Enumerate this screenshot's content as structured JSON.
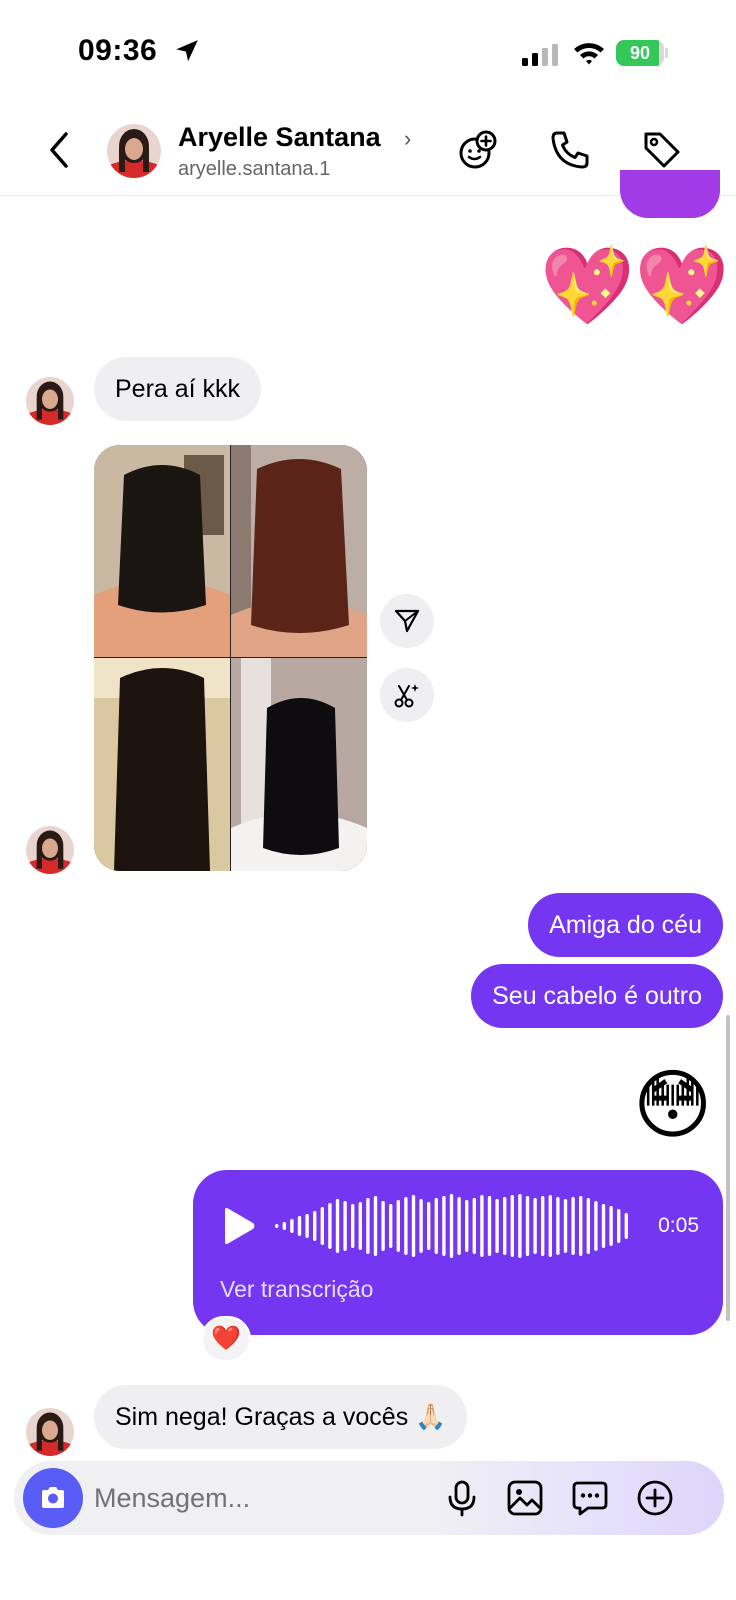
{
  "status_bar": {
    "time": "09:36",
    "battery_percent": "90",
    "battery_level": 0.9,
    "icons": [
      "location-arrow-icon",
      "cellular-signal-icon",
      "wifi-icon",
      "battery-icon"
    ]
  },
  "header": {
    "name": "Aryelle Santana",
    "chevron": "›",
    "handle": "aryelle.santana.1",
    "icons": [
      "back-icon",
      "add-sticker-icon",
      "phone-icon",
      "tag-icon"
    ]
  },
  "messages": {
    "m1_emoji": "💖💖",
    "m2_text": "Pera aí kkk",
    "m3_images": [
      "hair-photo-1",
      "hair-photo-2",
      "hair-photo-3",
      "hair-photo-4"
    ],
    "m4_text": "Amiga do céu",
    "m5_text": "Seu cabelo é outro",
    "m6_emoji": "😳",
    "m7_audio": {
      "duration": "0:05",
      "transcript_link": "Ver transcrição",
      "reaction": "❤️"
    },
    "m8_text": "Sim nega! Graças a vocês 🙏🏻"
  },
  "composer": {
    "placeholder": "Mensagem...",
    "icons": [
      "camera-icon",
      "microphone-icon",
      "gallery-icon",
      "sticker-chat-icon",
      "plus-icon"
    ]
  },
  "colors": {
    "outgoing_bubble": "#7436f0",
    "incoming_bubble": "#efeff2",
    "camera_button": "#5a5df5",
    "battery": "#34c759"
  }
}
